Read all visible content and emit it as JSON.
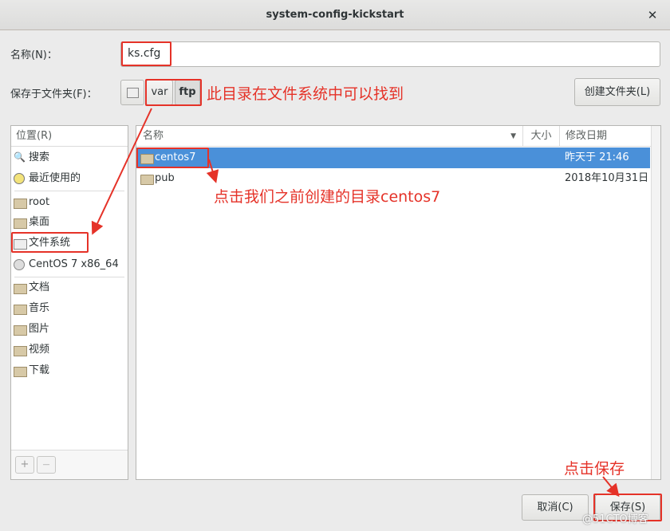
{
  "window": {
    "title": "system-config-kickstart",
    "close_glyph": "✕"
  },
  "name_field": {
    "label": "名称(N)：",
    "value": "ks.cfg"
  },
  "folder_field": {
    "label": "保存于文件夹(F)："
  },
  "path": {
    "segments": [
      "var",
      "ftp"
    ]
  },
  "create_folder_button": "创建文件夹(L)",
  "annotations": {
    "path_note": "此目录在文件系统中可以找到",
    "folder_note": "点击我们之前创建的目录centos7",
    "save_note": "点击保存"
  },
  "places": {
    "header": "位置(R)",
    "items": [
      {
        "label": "搜索",
        "icon": "search-icon"
      },
      {
        "label": "最近使用的",
        "icon": "recent-icon"
      },
      {
        "label": "root",
        "icon": "home-icon"
      },
      {
        "label": "桌面",
        "icon": "desktop-icon"
      },
      {
        "label": "文件系统",
        "icon": "drive-icon"
      },
      {
        "label": "CentOS 7 x86_64",
        "icon": "disc-icon"
      },
      {
        "label": "文档",
        "icon": "documents-icon"
      },
      {
        "label": "音乐",
        "icon": "music-icon"
      },
      {
        "label": "图片",
        "icon": "pictures-icon"
      },
      {
        "label": "视频",
        "icon": "videos-icon"
      },
      {
        "label": "下载",
        "icon": "downloads-icon"
      }
    ],
    "add_glyph": "+",
    "remove_glyph": "—"
  },
  "files": {
    "columns": [
      "名称",
      "大小",
      "修改日期"
    ],
    "rows": [
      {
        "name": "centos7",
        "size": "",
        "modified": "昨天于 21:46",
        "selected": true
      },
      {
        "name": "pub",
        "size": "",
        "modified": "2018年10月31日",
        "selected": false
      }
    ]
  },
  "buttons": {
    "cancel": "取消(C)",
    "save": "保存(S)"
  },
  "watermark": "@51CTO博客",
  "colors": {
    "selection": "#4a90d9",
    "annotation": "#e53228"
  }
}
